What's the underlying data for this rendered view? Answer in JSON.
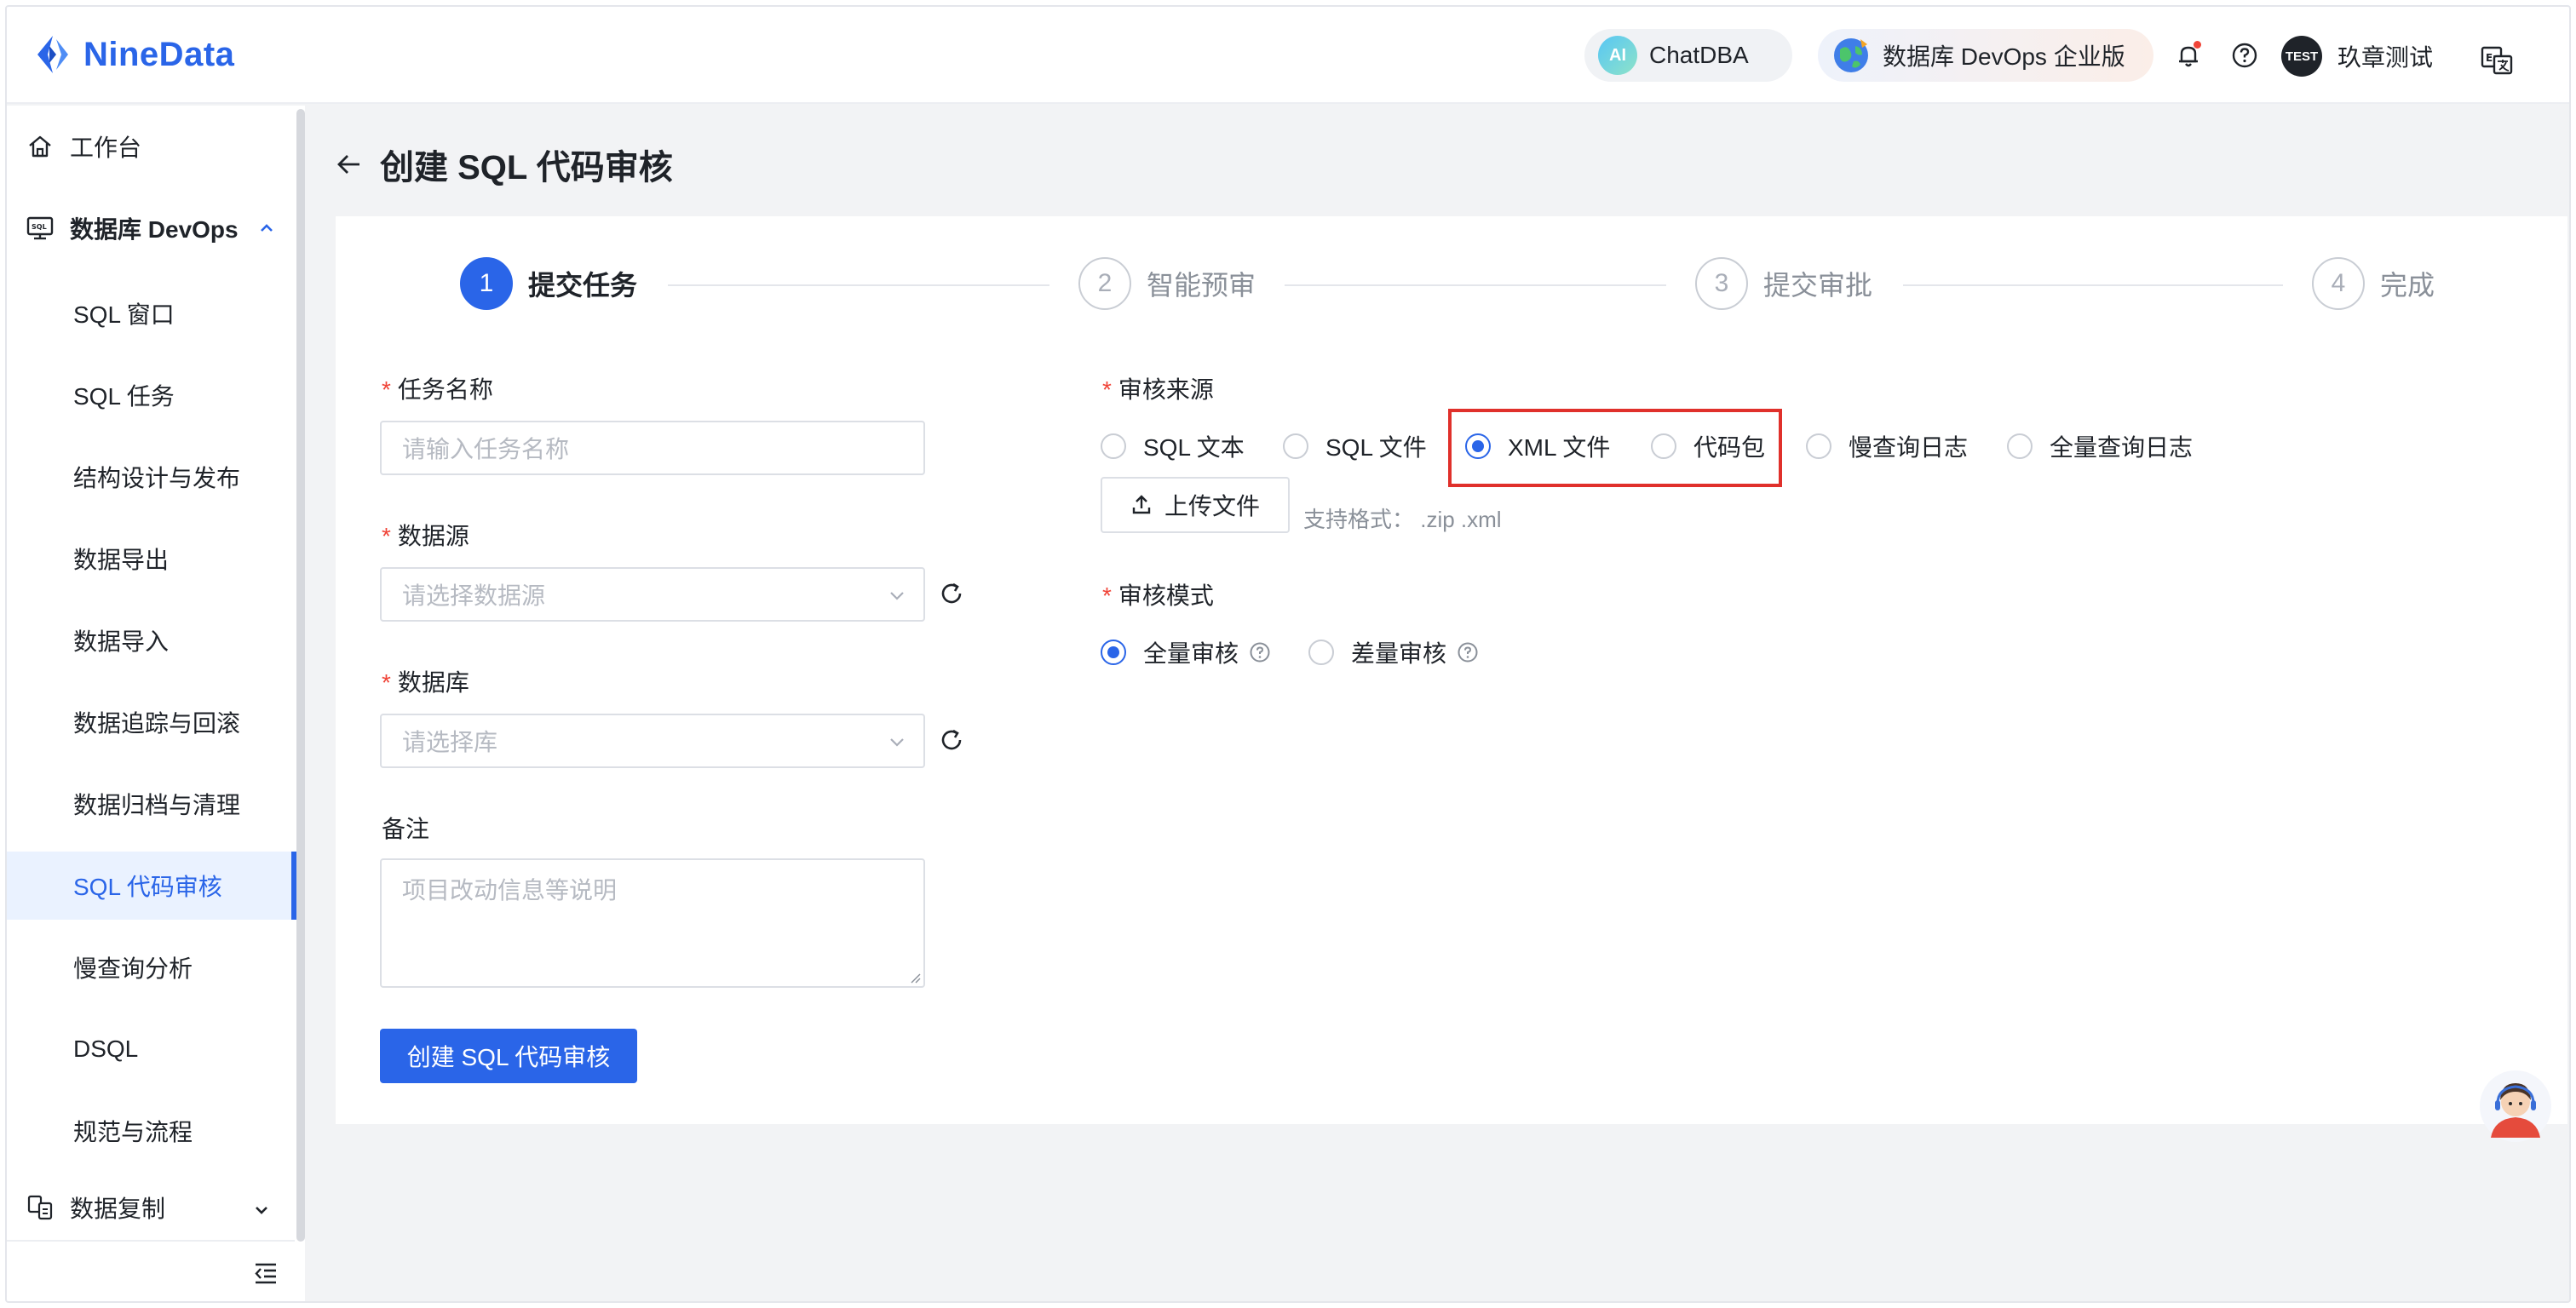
{
  "header": {
    "brand": "NineData",
    "chatdba_label": "ChatDBA",
    "ai_badge": "AI",
    "devops_label": "数据库 DevOps 企业版",
    "user_badge": "TEST",
    "user_name": "玖章测试"
  },
  "sidebar": {
    "workbench": "工作台",
    "devops_group": "数据库 DevOps",
    "items": [
      {
        "label": "SQL 窗口"
      },
      {
        "label": "SQL 任务"
      },
      {
        "label": "结构设计与发布"
      },
      {
        "label": "数据导出"
      },
      {
        "label": "数据导入"
      },
      {
        "label": "数据追踪与回滚"
      },
      {
        "label": "数据归档与清理"
      },
      {
        "label": "SQL 代码审核",
        "active": true
      },
      {
        "label": "慢查询分析"
      },
      {
        "label": "DSQL"
      },
      {
        "label": "规范与流程"
      }
    ],
    "replication_group": "数据复制"
  },
  "page": {
    "title": "创建 SQL 代码审核"
  },
  "steps": [
    {
      "num": "1",
      "label": "提交任务",
      "active": true
    },
    {
      "num": "2",
      "label": "智能预审"
    },
    {
      "num": "3",
      "label": "提交审批"
    },
    {
      "num": "4",
      "label": "完成"
    }
  ],
  "form": {
    "required_mark": "*",
    "task_name_label": "任务名称",
    "task_name_placeholder": "请输入任务名称",
    "datasource_label": "数据源",
    "datasource_placeholder": "请选择数据源",
    "database_label": "数据库",
    "database_placeholder": "请选择库",
    "remark_label": "备注",
    "remark_placeholder": "项目改动信息等说明",
    "source_label": "审核来源",
    "source_options": [
      {
        "label": "SQL 文本",
        "selected": false
      },
      {
        "label": "SQL 文件",
        "selected": false
      },
      {
        "label": "XML 文件",
        "selected": true
      },
      {
        "label": "代码包",
        "selected": false
      },
      {
        "label": "慢查询日志",
        "selected": false
      },
      {
        "label": "全量查询日志",
        "selected": false
      }
    ],
    "upload_label": "上传文件",
    "upload_hint": "支持格式： .zip .xml",
    "mode_label": "审核模式",
    "mode_options": [
      {
        "label": "全量审核",
        "selected": true
      },
      {
        "label": "差量审核",
        "selected": false
      }
    ],
    "submit_label": "创建 SQL 代码审核"
  },
  "colors": {
    "primary": "#2a65e8",
    "highlight_border": "#e0302b",
    "required": "#f04438"
  }
}
